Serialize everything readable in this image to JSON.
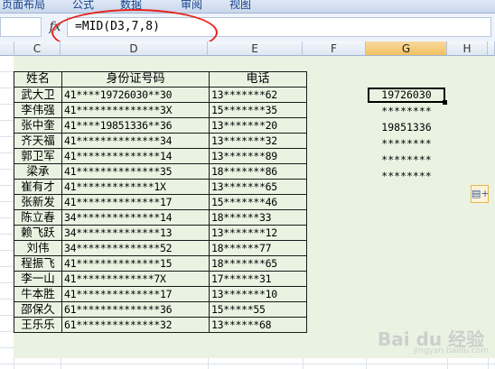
{
  "ribbon": {
    "tabs": [
      "页面布局",
      "公式",
      "数据",
      "审阅",
      "视图"
    ]
  },
  "formula_bar": {
    "fx_label": "fx",
    "formula": "=MID(D3,7,8)"
  },
  "columns": {
    "headers": [
      "C",
      "D",
      "E",
      "F",
      "G",
      "H"
    ],
    "selected": "G"
  },
  "table": {
    "headers": [
      "姓名",
      "身份证号码",
      "电话"
    ],
    "rows": [
      [
        "武大卫",
        "41****19726030**30",
        "13*******62"
      ],
      [
        "李伟强",
        "41**************3X",
        "15*******35"
      ],
      [
        "张中奎",
        "41****19851336**36",
        "13*******20"
      ],
      [
        "齐天福",
        "41**************34",
        "13*******32"
      ],
      [
        "郭卫军",
        "41**************14",
        "13*******89"
      ],
      [
        "梁承",
        "41**************35",
        "18*******86"
      ],
      [
        "崔有才",
        "41*************1X",
        "13*******65"
      ],
      [
        "张新发",
        "41**************17",
        "15*******46"
      ],
      [
        "陈立春",
        "34**************14",
        "18******33"
      ],
      [
        "赖飞跃",
        "34**************13",
        "13*******12"
      ],
      [
        "刘伟",
        "34**************52",
        "18******77"
      ],
      [
        "程振飞",
        "41**************15",
        "18*******65"
      ],
      [
        "李一山",
        "41*************7X",
        "17******31"
      ],
      [
        "牛本胜",
        "41**************17",
        "13*******10"
      ],
      [
        "邵保久",
        "61**************36",
        "15*****55"
      ],
      [
        "王乐乐",
        "61**************32",
        "13******68"
      ]
    ]
  },
  "results": {
    "values": [
      "19726030",
      "********",
      "19851336",
      "********",
      "********",
      "********"
    ]
  },
  "paste_options": {
    "icon": "paste-options-icon"
  },
  "watermark": {
    "text": "Bai du 经验",
    "sub": "jingyan.baidu.com"
  }
}
